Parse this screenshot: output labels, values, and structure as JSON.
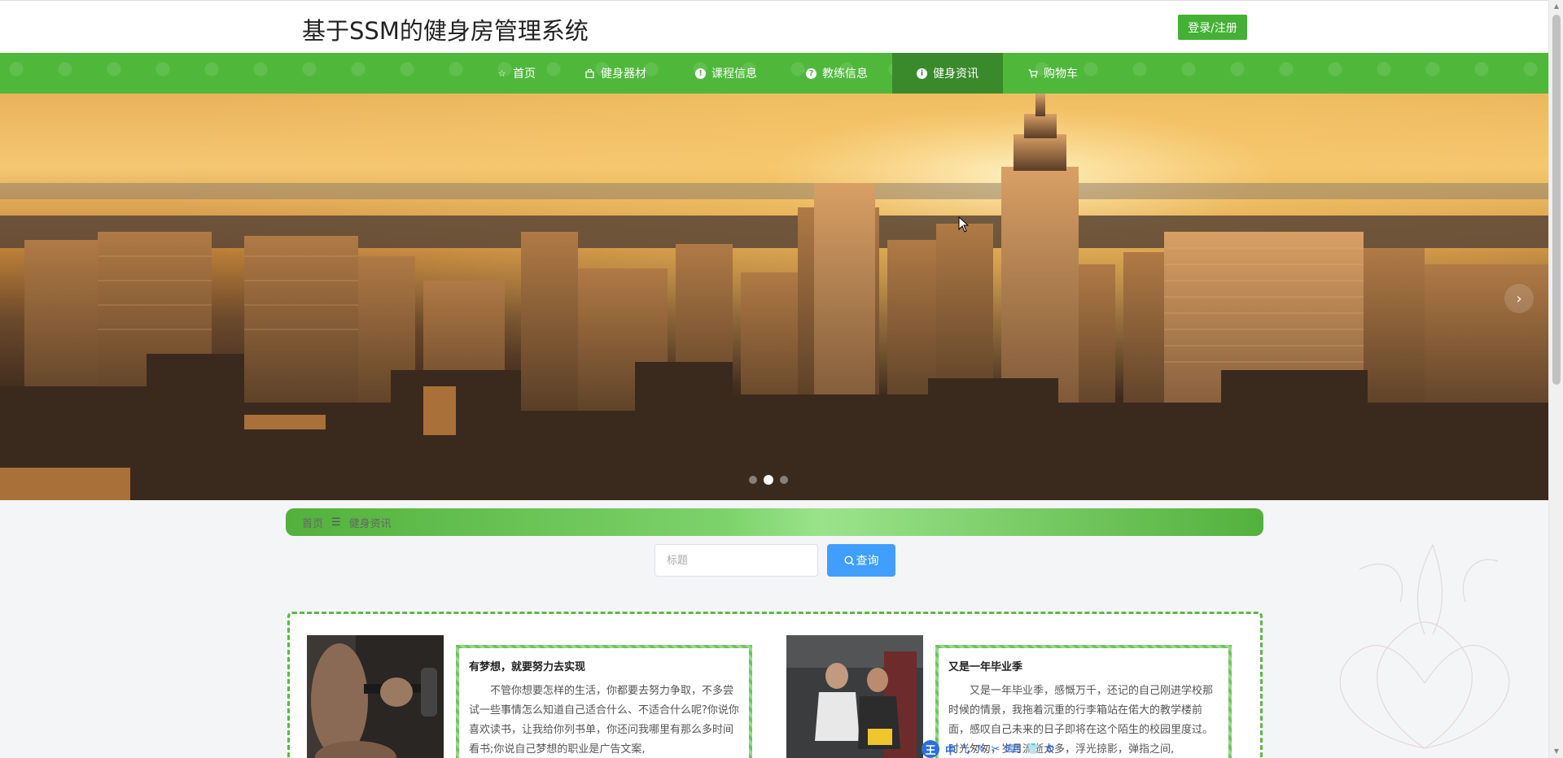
{
  "header": {
    "site_title": "基于SSM的健身房管理系统",
    "login_label": "登录/注册"
  },
  "nav": {
    "items": [
      {
        "label": "首页",
        "icon": "star-icon"
      },
      {
        "label": "健身器材",
        "icon": "bag-icon"
      },
      {
        "label": "课程信息",
        "icon": "exclamation-icon"
      },
      {
        "label": "教练信息",
        "icon": "question-icon"
      },
      {
        "label": "健身资讯",
        "icon": "info-icon",
        "active": true
      },
      {
        "label": "购物车",
        "icon": "cart-icon"
      }
    ]
  },
  "banner": {
    "slide_count": 3,
    "active_slide": 2,
    "next_label": "›"
  },
  "breadcrumb": {
    "home": "首页",
    "separator": "☰",
    "current": "健身资讯"
  },
  "search": {
    "placeholder": "标题",
    "value": "",
    "button_label": "查询"
  },
  "news": [
    {
      "title": "有梦想，就要努力去实现",
      "body": "不管你想要怎样的生活，你都要去努力争取，不多尝试一些事情怎么知道自己适合什么、不适合什么呢?你说你喜欢读书，让我给你列书单，你还问我哪里有那么多时间看书;你说自己梦想的职业是广告文案,"
    },
    {
      "title": "又是一年毕业季",
      "body": "又是一年毕业季，感慨万千，还记的自己刚进学校那时候的情景，我拖着沉重的行李箱站在偌大的教学楼前面，感叹自己未来的日子即将在这个陌生的校园里度过。时光匆匆，岁月流逝太多，浮光掠影，弹指之间,"
    }
  ],
  "ime": {
    "logo": "王",
    "items": [
      "中",
      "°,",
      "✎",
      "✂",
      "⌨",
      "👕",
      "⚙"
    ]
  },
  "colors": {
    "brand_green": "#4fb83b",
    "nav_active": "#3a8a2c",
    "search_blue": "#409eff"
  }
}
